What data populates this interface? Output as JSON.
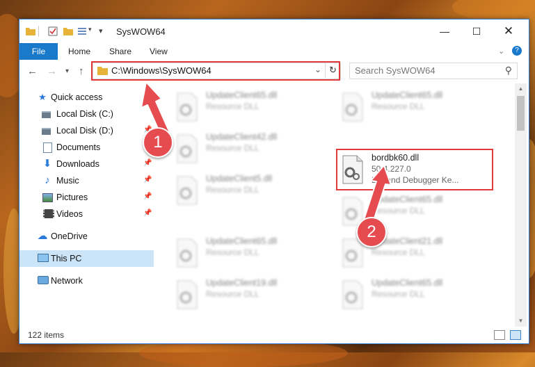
{
  "window": {
    "title": "SysWOW64"
  },
  "ribbon": {
    "tabs": [
      "File",
      "Home",
      "Share",
      "View"
    ]
  },
  "address": {
    "path": "C:\\Windows\\SysWOW64"
  },
  "search": {
    "placeholder": "Search SysWOW64"
  },
  "nav": {
    "items": [
      {
        "label": "Quick access",
        "icon": "star-icon"
      },
      {
        "label": "Local Disk (C:)",
        "icon": "drive-icon"
      },
      {
        "label": "Local Disk (D:)",
        "icon": "drive-icon"
      },
      {
        "label": "Documents",
        "icon": "documents-icon"
      },
      {
        "label": "Downloads",
        "icon": "download-icon"
      },
      {
        "label": "Music",
        "icon": "music-icon"
      },
      {
        "label": "Pictures",
        "icon": "pictures-icon"
      },
      {
        "label": "Videos",
        "icon": "videos-icon"
      },
      {
        "label": "OneDrive",
        "icon": "cloud-icon"
      },
      {
        "label": "This PC",
        "icon": "computer-icon"
      },
      {
        "label": "Network",
        "icon": "network-icon"
      }
    ]
  },
  "files": [
    {
      "name": "UpdateClient65.dll",
      "desc": "Resource DLL"
    },
    {
      "name": "UpdateClient65.dll",
      "desc": "Resource DLL"
    },
    {
      "name": "UpdateClient42.dll",
      "desc": "Resource DLL"
    },
    {
      "name": "bordbk60.dll",
      "version": "50.4.227.0",
      "desc": "Borland Debugger Ke..."
    },
    {
      "name": "UpdateClient5.dll",
      "desc": "Resource DLL"
    },
    {
      "name": "UpdateClient65.dll",
      "desc": "Resource DLL"
    },
    {
      "name": "UpdateClient65.dll",
      "desc": "Resource DLL"
    },
    {
      "name": "UpdateClient21.dll",
      "desc": "Resource DLL"
    },
    {
      "name": "UpdateClient19.dll",
      "desc": "Resource DLL"
    },
    {
      "name": "UpdateClient65.dll",
      "desc": "Resource DLL"
    }
  ],
  "status": {
    "item_count": "122 items"
  },
  "annotations": {
    "step1": "1",
    "step2": "2"
  },
  "colors": {
    "accent": "#1979ca",
    "highlight": "#e0393e"
  }
}
